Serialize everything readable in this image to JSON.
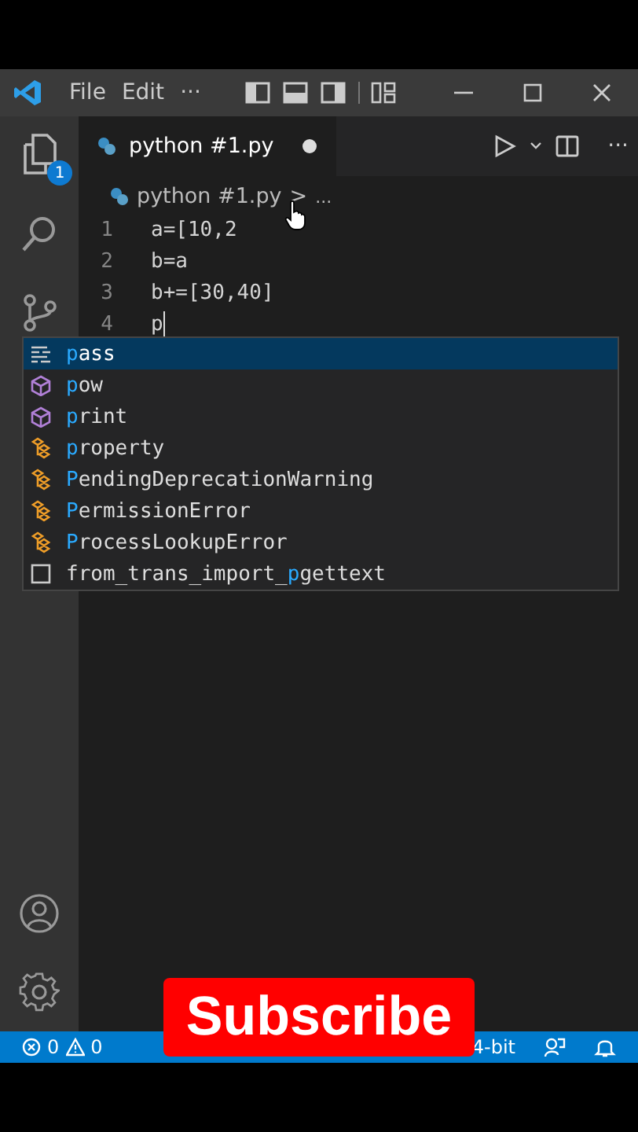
{
  "title_bar": {
    "menus": [
      "File",
      "Edit",
      "···"
    ]
  },
  "activity_bar": {
    "explorer_badge": "1"
  },
  "tabs": [
    {
      "label": "python #1.py",
      "selected": true,
      "modified": true
    }
  ],
  "editor_actions": {
    "more": "···"
  },
  "breadcrumbs": {
    "file": "python #1.py",
    "separator": ">",
    "more": "..."
  },
  "lines": [
    {
      "number": "1",
      "code": "a=[10,2"
    },
    {
      "number": "2",
      "code": "b=a"
    },
    {
      "number": "3",
      "code": "b+=[30,40]"
    },
    {
      "number": "4",
      "code": "p"
    }
  ],
  "suggestions": [
    {
      "kind": "keyword",
      "match": "p",
      "after": "ass",
      "selected": true
    },
    {
      "kind": "function",
      "match": "p",
      "after": "ow",
      "selected": false
    },
    {
      "kind": "function",
      "match": "p",
      "after": "rint",
      "selected": false
    },
    {
      "kind": "class",
      "match": "p",
      "after": "roperty",
      "selected": false
    },
    {
      "kind": "class",
      "match": "P",
      "after": "endingDeprecationWarning",
      "selected": false
    },
    {
      "kind": "class",
      "match": "P",
      "after": "ermissionError",
      "selected": false
    },
    {
      "kind": "class",
      "match": "P",
      "after": "rocessLookupError",
      "selected": false
    },
    {
      "kind": "text",
      "before": "from_trans_import_",
      "match": "p",
      "after": "gettext",
      "selected": false
    }
  ],
  "status_bar": {
    "errors": "0",
    "warnings": "0",
    "right_text": "4-bit"
  },
  "overlay": {
    "label": "Subscribe"
  }
}
